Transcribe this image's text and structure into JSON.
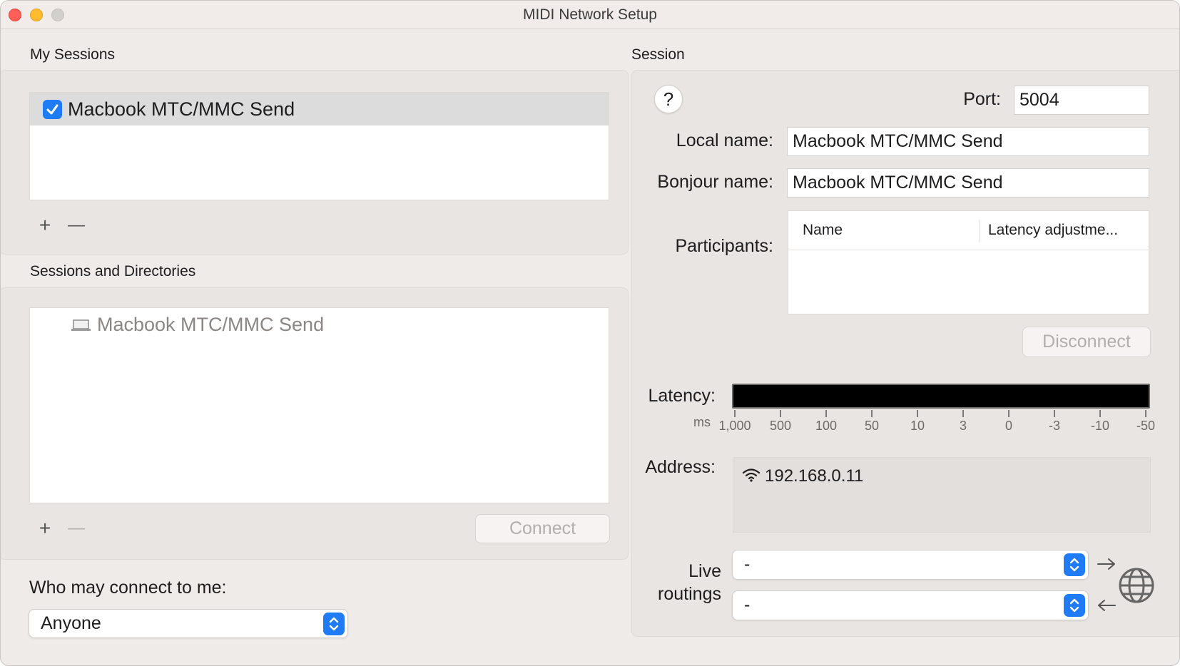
{
  "window": {
    "title": "MIDI Network Setup"
  },
  "my_sessions": {
    "label": "My Sessions",
    "items": [
      {
        "name": "Macbook MTC/MMC Send",
        "enabled": true
      }
    ],
    "add_label": "+",
    "remove_label": "—"
  },
  "directories": {
    "label": "Sessions and Directories",
    "items": [
      {
        "name": "Macbook MTC/MMC Send",
        "icon": "laptop-icon"
      }
    ],
    "add_label": "+",
    "remove_label": "—",
    "connect_label": "Connect"
  },
  "access": {
    "label": "Who may connect to me:",
    "selected": "Anyone"
  },
  "session": {
    "label": "Session",
    "help_label": "?",
    "port_label": "Port:",
    "port_value": "5004",
    "local_name_label": "Local name:",
    "local_name_value": "Macbook MTC/MMC Send",
    "bonjour_name_label": "Bonjour name:",
    "bonjour_name_value": "Macbook MTC/MMC Send",
    "participants_label": "Participants:",
    "participants_columns": [
      "Name",
      "Latency adjustme..."
    ],
    "disconnect_label": "Disconnect",
    "latency_label": "Latency:",
    "latency_unit": "ms",
    "latency_ticks": [
      "1,000",
      "500",
      "100",
      "50",
      "10",
      "3",
      "0",
      "-3",
      "-10",
      "-50"
    ],
    "address_label": "Address:",
    "address_value": "192.168.0.11",
    "live_routings_label_1": "Live",
    "live_routings_label_2": "routings",
    "routing_in": "-",
    "routing_out": "-"
  },
  "colors": {
    "accent": "#1f7cf6",
    "close": "#fe5f57",
    "minimize": "#febc2e"
  }
}
